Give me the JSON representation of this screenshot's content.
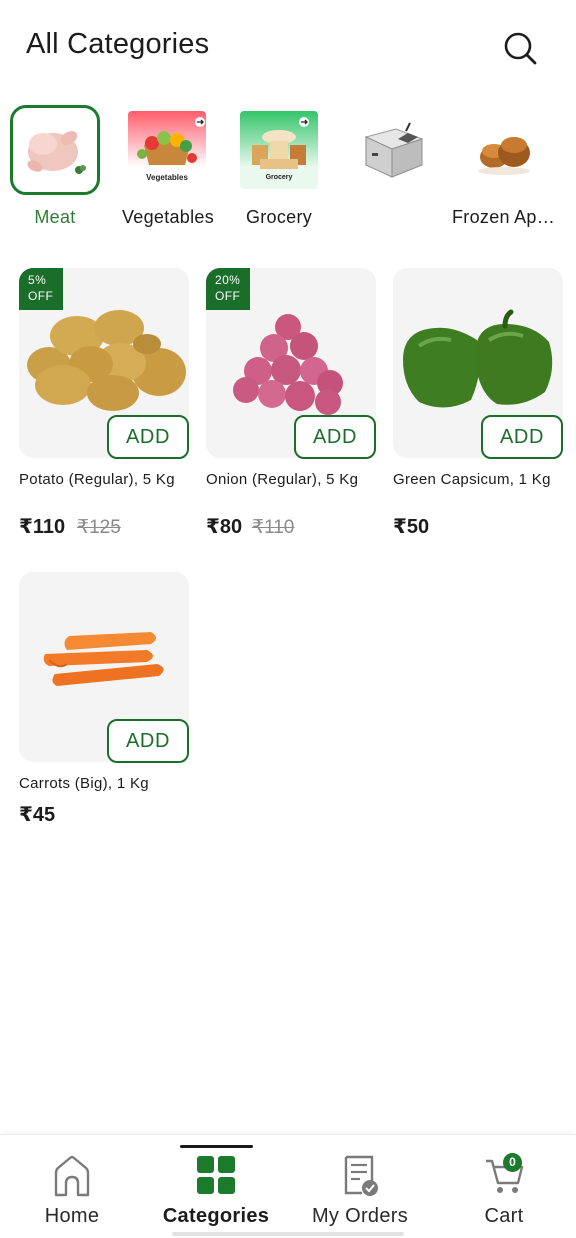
{
  "header": {
    "title": "All Categories",
    "search_icon": "search-icon"
  },
  "categories": [
    {
      "label": "Meat",
      "thumb_text": "",
      "active": true
    },
    {
      "label": "Vegetables",
      "thumb_text": "Vegetables",
      "active": false
    },
    {
      "label": "Grocery",
      "thumb_text": "Grocery",
      "active": false
    },
    {
      "label": "",
      "thumb_text": "",
      "active": false
    },
    {
      "label": "Frozen Appetizers",
      "thumb_text": "",
      "active": false
    }
  ],
  "products": [
    {
      "name": "Potato (Regular), 5 Kg",
      "price": "₹110",
      "mrp": "₹125",
      "discount": "5%",
      "discount_suffix": "OFF",
      "add_label": "ADD"
    },
    {
      "name": "Onion (Regular), 5 Kg",
      "price": "₹80",
      "mrp": "₹110",
      "discount": "20%",
      "discount_suffix": "OFF",
      "add_label": "ADD"
    },
    {
      "name": "Green Capsicum, 1 Kg",
      "price": "₹50",
      "mrp": "",
      "discount": "",
      "discount_suffix": "",
      "add_label": "ADD"
    },
    {
      "name": "Carrots (Big), 1 Kg",
      "price": "₹45",
      "mrp": "",
      "discount": "",
      "discount_suffix": "",
      "add_label": "ADD"
    }
  ],
  "bottom_nav": {
    "items": [
      {
        "label": "Home",
        "icon": "home-icon",
        "active": false
      },
      {
        "label": "Categories",
        "icon": "grid-icon",
        "active": true
      },
      {
        "label": "My Orders",
        "icon": "orders-icon",
        "active": false
      },
      {
        "label": "Cart",
        "icon": "cart-icon",
        "active": false
      }
    ],
    "cart_count": "0"
  },
  "colors": {
    "accent": "#1b7a2c",
    "badge_bg": "#1b6e2a",
    "card_bg": "#f4f4f4",
    "text": "#1c1c1c",
    "muted": "#8a8a8a"
  }
}
